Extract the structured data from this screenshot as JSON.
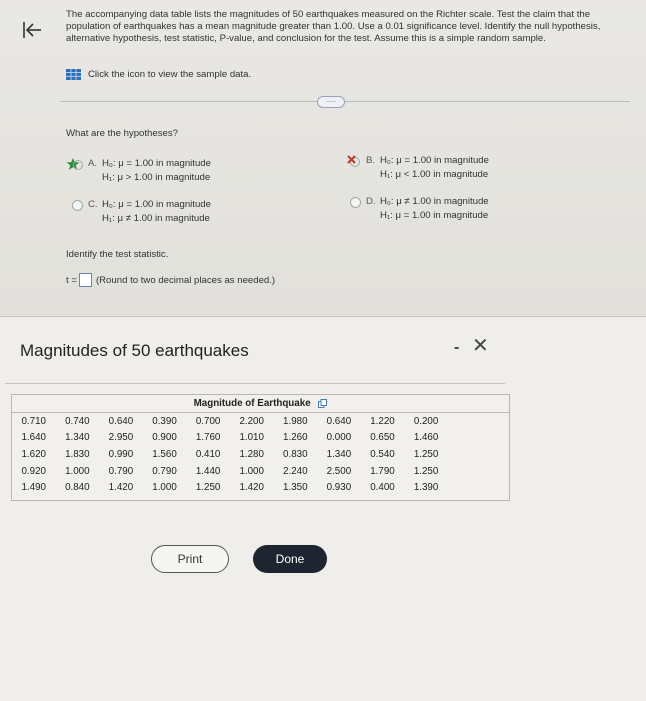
{
  "question": {
    "text": "The accompanying data table lists the magnitudes of 50 earthquakes measured on the Richter scale. Test the claim that the population of earthquakes has a mean magnitude greater than 1.00. Use a 0.01 significance level. Identify the null hypothesis, alternative hypothesis, test statistic, P-value, and conclusion for the test. Assume this is a simple random sample.",
    "sample_link": "Click the icon to view the sample data.",
    "more_label": "....."
  },
  "hypotheses": {
    "prompt": "What are the hypotheses?",
    "options": [
      {
        "letter": "A.",
        "h0": "H₀: μ = 1.00 in magnitude",
        "h1": "H₁: μ > 1.00 in magnitude",
        "state": "correct"
      },
      {
        "letter": "B.",
        "h0": "H₀: μ = 1.00 in magnitude",
        "h1": "H₁: μ < 1.00 in magnitude",
        "state": "incorrect"
      },
      {
        "letter": "C.",
        "h0": "H₀: μ = 1.00 in magnitude",
        "h1": "H₁: μ ≠ 1.00 in magnitude",
        "state": "unselected"
      },
      {
        "letter": "D.",
        "h0": "H₀: μ ≠ 1.00 in magnitude",
        "h1": "H₁: μ = 1.00 in magnitude",
        "state": "unselected"
      }
    ]
  },
  "test_statistic": {
    "prompt": "Identify the test statistic.",
    "label": "t =",
    "value": "",
    "hint": "(Round to two decimal places as needed.)"
  },
  "dialog": {
    "title": "Magnitudes of 50 earthquakes",
    "minimize": "-",
    "close": "✕",
    "table_caption": "Magnitude of Earthquake",
    "rows": [
      [
        "0.710",
        "0.740",
        "0.640",
        "0.390",
        "0.700",
        "2.200",
        "1.980",
        "0.640",
        "1.220",
        "0.200"
      ],
      [
        "1.640",
        "1.340",
        "2.950",
        "0.900",
        "1.760",
        "1.010",
        "1.260",
        "0.000",
        "0.650",
        "1.460"
      ],
      [
        "1.620",
        "1.830",
        "0.990",
        "1.560",
        "0.410",
        "1.280",
        "0.830",
        "1.340",
        "0.540",
        "1.250"
      ],
      [
        "0.920",
        "1.000",
        "0.790",
        "0.790",
        "1.440",
        "1.000",
        "2.240",
        "2.500",
        "1.790",
        "1.250"
      ],
      [
        "1.490",
        "0.840",
        "1.420",
        "1.000",
        "1.250",
        "1.420",
        "1.350",
        "0.930",
        "0.400",
        "1.390"
      ]
    ],
    "print_label": "Print",
    "done_label": "Done"
  },
  "colors": {
    "correct": "#2e8b3a",
    "incorrect": "#c0392b",
    "accent": "#6d83b8",
    "done_bg": "#1e2430"
  },
  "icons": {
    "back": "back-arrow-icon",
    "table": "table-icon",
    "copy": "copy-icon"
  }
}
